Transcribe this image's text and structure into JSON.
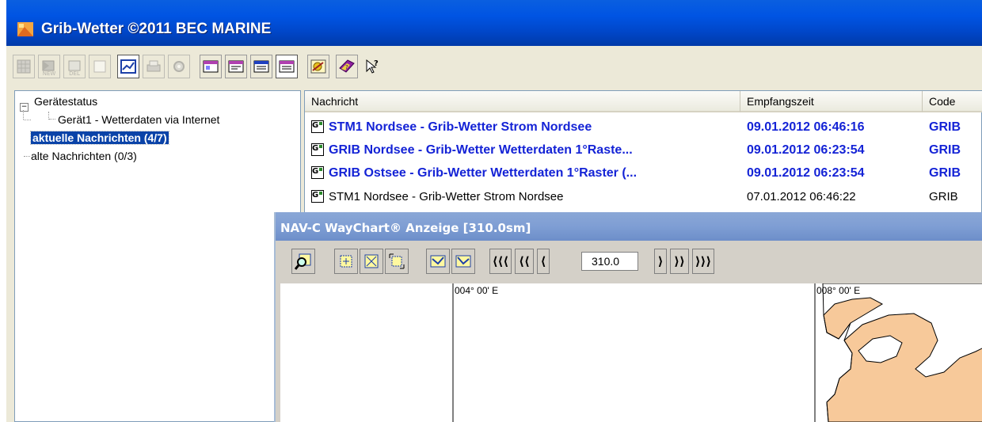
{
  "window": {
    "title": "Grib-Wetter ©2011 BEC MARINE"
  },
  "toolbar": {
    "new_label": "NEW",
    "del_label": "DEL"
  },
  "tree": {
    "items": [
      {
        "label": "Gerätestatus"
      },
      {
        "label": "Gerät1 - Wetterdaten via Internet"
      },
      {
        "label": "aktuelle Nachrichten (4/7)"
      },
      {
        "label": "alte Nachrichten (0/3)"
      }
    ]
  },
  "list": {
    "columns": [
      "Nachricht",
      "Empfangszeit",
      "Code"
    ],
    "rows": [
      {
        "message": "STM1 Nordsee - Grib-Wetter Strom Nordsee",
        "time": "09.01.2012 06:46:16",
        "code": "GRIB"
      },
      {
        "message": "GRIB Nordsee - Grib-Wetter Wetterdaten 1°Raste...",
        "time": "09.01.2012 06:23:54",
        "code": "GRIB"
      },
      {
        "message": "GRIB Ostsee - Grib-Wetter Wetterdaten 1°Raster (...",
        "time": "09.01.2012 06:23:54",
        "code": "GRIB"
      },
      {
        "message": "STM1 Nordsee - Grib-Wetter Strom Nordsee",
        "time": "07.01.2012 06:46:22",
        "code": "GRIB"
      }
    ],
    "icon_letter": "G"
  },
  "waychart": {
    "title": "NAV-C WayChart® Anzeige [310.0sm]",
    "range_value": "310.0",
    "nav": {
      "back3": "⟨⟨⟨",
      "back2": "⟨⟨",
      "back1": "⟨",
      "fwd1": "⟩",
      "fwd2": "⟩⟩",
      "fwd3": "⟩⟩⟩"
    },
    "lon_labels": [
      "004° 00' E",
      "008° 00' E"
    ]
  },
  "colors": {
    "title_bar": "#0054e3",
    "selection": "#0a43a8",
    "bold_row": "#1423d6",
    "land": "#f7c99a"
  }
}
